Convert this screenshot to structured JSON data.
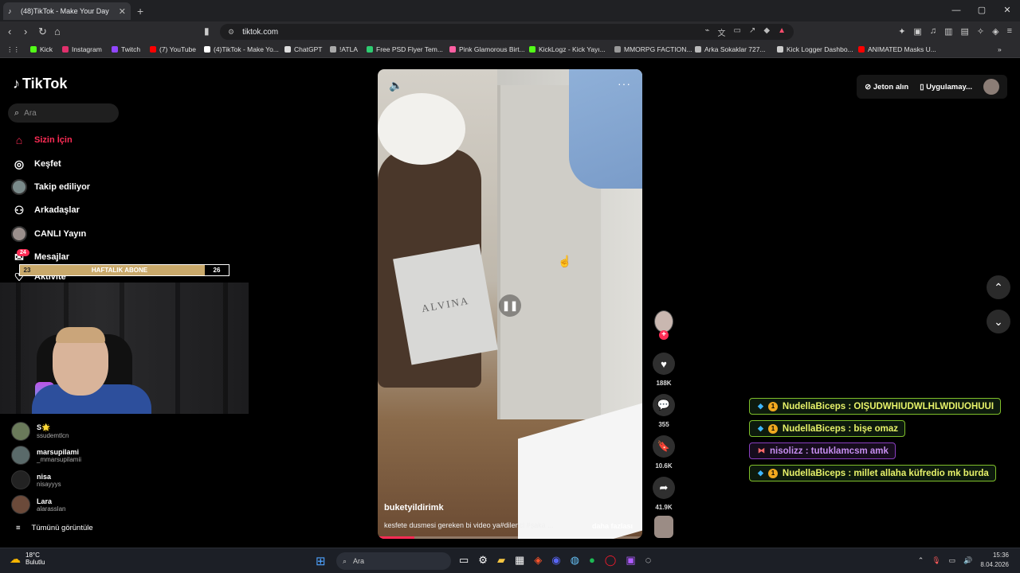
{
  "browser": {
    "tab_title": "(48)TikTok - Make Your Day",
    "tab_close": "✕",
    "new_tab": "+",
    "url": "tiktok.com",
    "window_controls": [
      "—",
      "▢",
      "✕"
    ]
  },
  "bookmarks": [
    {
      "label": "Kick",
      "color": "#53fc18"
    },
    {
      "label": "Instagram",
      "color": "#e1306c"
    },
    {
      "label": "Twitch",
      "color": "#9146ff"
    },
    {
      "label": "(7) YouTube",
      "color": "#ff0000"
    },
    {
      "label": "(4)TikTok - Make Yo...",
      "color": "#ffffff"
    },
    {
      "label": "ChatGPT",
      "color": "#dddddd"
    },
    {
      "label": "!ATLA",
      "color": "#aaaaaa"
    },
    {
      "label": "Free PSD Flyer Tem...",
      "color": "#2ecc71"
    },
    {
      "label": "Pink Glamorous Birt...",
      "color": "#ff5fa2"
    },
    {
      "label": "KickLogz - Kick Yayı...",
      "color": "#53fc18"
    },
    {
      "label": "MMORPG FACTION...",
      "color": "#999999"
    },
    {
      "label": "Arka Sokaklar 727...",
      "color": "#bbbbbb"
    },
    {
      "label": "Kick Logger Dashbo...",
      "color": "#cccccc"
    },
    {
      "label": "ANIMATED Masks U...",
      "color": "#ff0000"
    }
  ],
  "sidebar": {
    "logo": "TikTok",
    "search_placeholder": "Ara",
    "nav": [
      {
        "label": "Sizin İçin",
        "icon": "⌂"
      },
      {
        "label": "Keşfet",
        "icon": "◎"
      },
      {
        "label": "Takip ediliyor",
        "icon": ""
      },
      {
        "label": "Arkadaşlar",
        "icon": "⚇"
      },
      {
        "label": "CANLI Yayın",
        "icon": ""
      },
      {
        "label": "Mesajlar",
        "icon": "✉"
      },
      {
        "label": "Aktivite",
        "icon": "♡"
      }
    ],
    "messages_badge": "24",
    "following": [
      {
        "name": "S🌟",
        "handle": "ssudemtlcn"
      },
      {
        "name": "marsupilami",
        "handle": "_mmarsupilamii"
      },
      {
        "name": "nisa",
        "handle": "nisayyys"
      },
      {
        "name": "Lara",
        "handle": "alarasslan"
      }
    ],
    "see_all": "Tümünü görüntüle"
  },
  "sub_goal": {
    "left": "23",
    "label": "HAFTALIK ABONE",
    "right": "26"
  },
  "video": {
    "author": "buketyildirimk",
    "caption": "kesfete dusmesi gereken bi video ya#dilenci #şaka ...",
    "more": "daha fazlası",
    "bag_text": "ALVINA",
    "progress": 0.14
  },
  "actions": [
    {
      "name": "like",
      "icon": "♥",
      "count": "188K"
    },
    {
      "name": "comment",
      "icon": "💬",
      "count": "355"
    },
    {
      "name": "save",
      "icon": "🔖",
      "count": "10.6K"
    },
    {
      "name": "share",
      "icon": "➦",
      "count": "41.9K"
    }
  ],
  "top_right": {
    "coins": "Jeton alın",
    "app": "Uygulamay..."
  },
  "chat": [
    {
      "user": "NudellaBiceps",
      "text": "NudellaBiceps : OIŞUDWHIUDWLHLWDIUOHUUI",
      "style": "green"
    },
    {
      "user": "NudellaBiceps",
      "text": "NudellaBiceps : bişe omaz",
      "style": "green"
    },
    {
      "user": "nisolizz",
      "text": "nisolizz : tutuklamcsm amk",
      "style": "purple"
    },
    {
      "user": "NudellaBiceps",
      "text": "NudellaBiceps : millet allaha küfredio mk burda",
      "style": "green"
    }
  ],
  "taskbar": {
    "temperature": "18°C",
    "weather": "Bulutlu",
    "search": "Ara",
    "time": "15:36",
    "date": "8.04.2026"
  }
}
